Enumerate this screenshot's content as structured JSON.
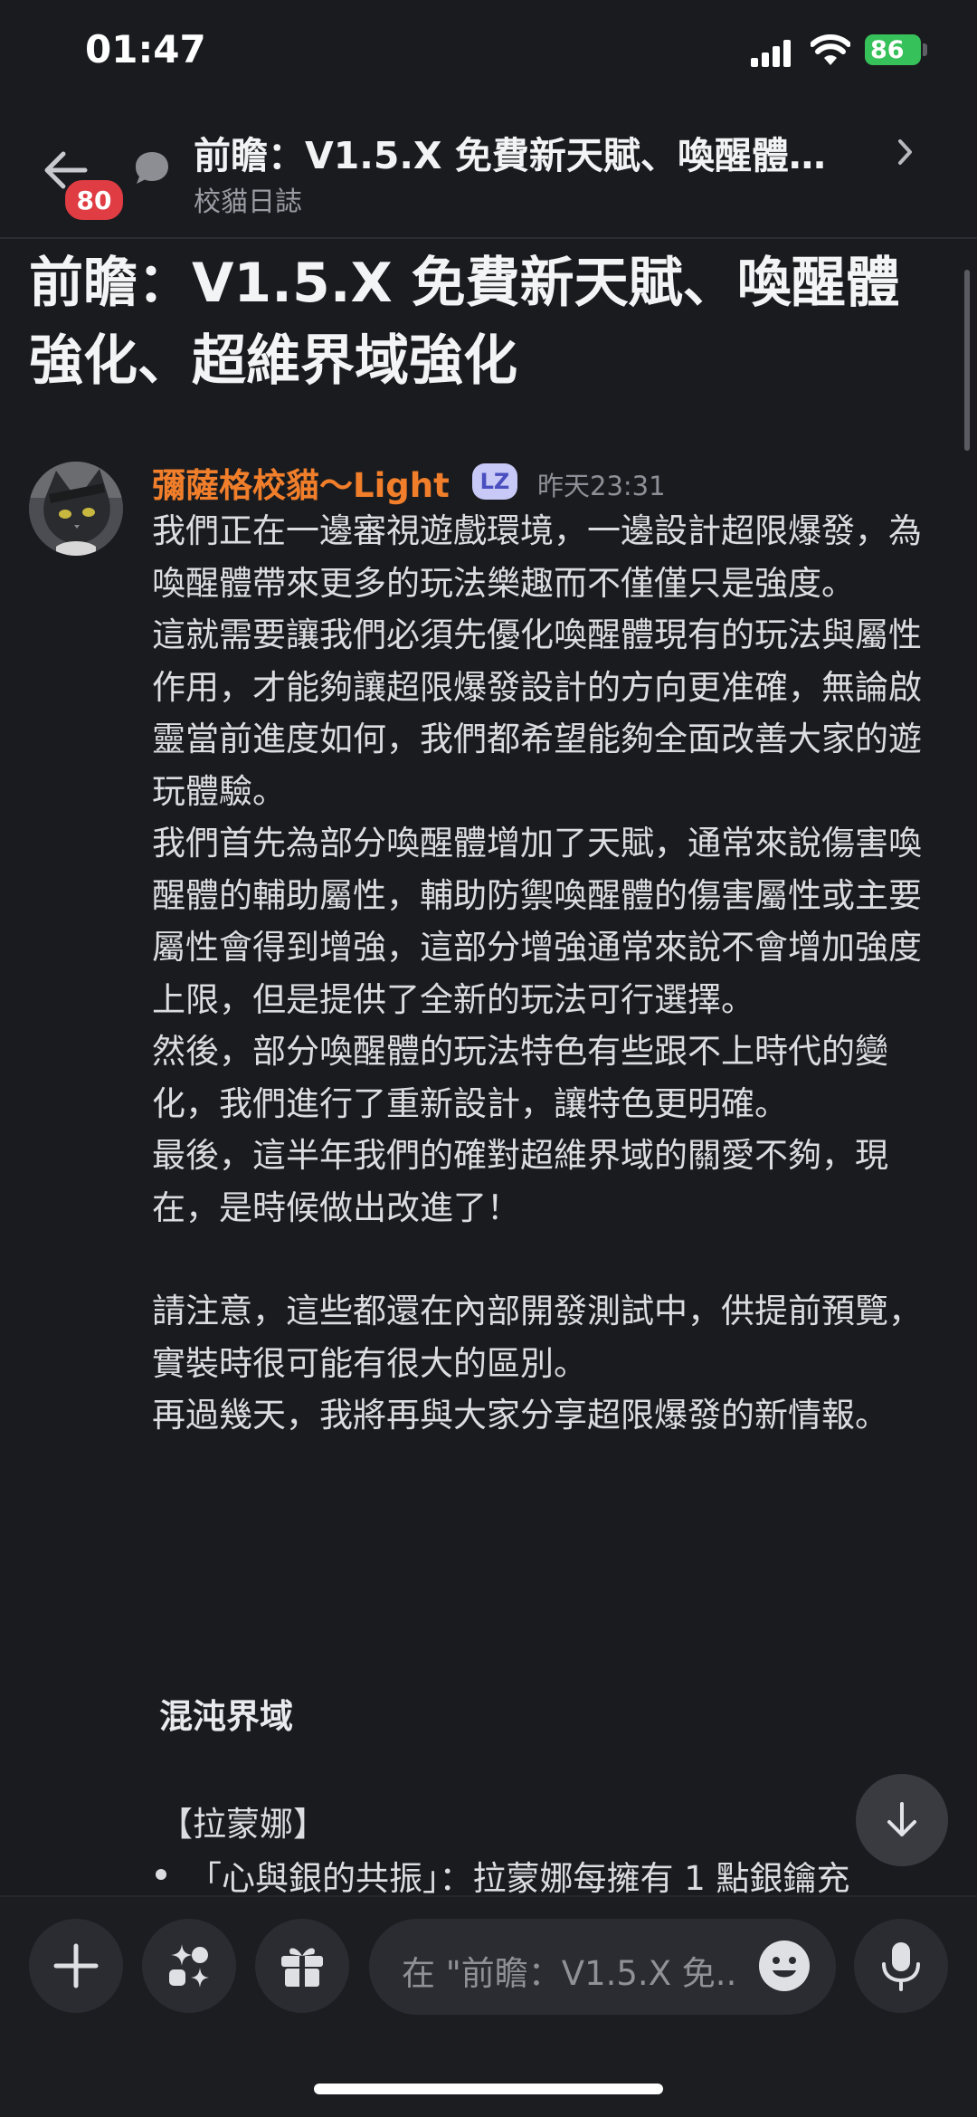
{
  "status_bar": {
    "time": "01:47",
    "battery": "86"
  },
  "header": {
    "back_badge": "80",
    "title": "前瞻：V1.5.X 免費新天賦、喚醒體…",
    "subtitle": "校貓日誌"
  },
  "post": {
    "title_line1": "前瞻：V1.5.X 免費新天賦、喚醒體",
    "title_line2": "強化、超維界域強化"
  },
  "message": {
    "author": "彌薩格校貓～Light",
    "author_tag": "LZ",
    "timestamp": "昨天23:31",
    "paragraphs": [
      "我們正在一邊審視遊戲環境，一邊設計超限爆發，為喚醒體帶來更多的玩法樂趣而不僅僅只是強度。",
      "這就需要讓我們必須先優化喚醒體現有的玩法與屬性作用，才能夠讓超限爆發設計的方向更准確，無論啟靈當前進度如何，我們都希望能夠全面改善大家的遊玩體驗。",
      "我們首先為部分喚醒體增加了天賦，通常來說傷害喚醒體的輔助屬性，輔助防禦喚醒體的傷害屬性或主要屬性會得到增強，這部分增強通常來說不會增加強度上限，但是提供了全新的玩法可行選擇。",
      "然後，部分喚醒體的玩法特色有些跟不上時代的變化，我們進行了重新設計，讓特色更明確。",
      "最後，這半年我們的確對超維界域的關愛不夠，現在，是時候做出改進了！",
      "請注意，這些都還在內部開發測試中，供提前預覽，實裝時很可能有很大的區別。",
      "再過幾天，我將再與大家分享超限爆發的新情報。"
    ],
    "section_title": "混沌界域",
    "subsection": "【拉蒙娜】",
    "bullet": "「心與銀的共振」：拉蒙娜每擁有 1 點銀鑰充"
  },
  "composer": {
    "placeholder": "在 \"前瞻：V1.5.X 免.."
  },
  "icons": {
    "back": "back-arrow-icon",
    "chat": "chat-bubble-icon",
    "chevron": "chevron-right-icon",
    "scroll_down": "arrow-down-icon",
    "plus": "plus-icon",
    "apps": "apps-sparkle-icon",
    "gift": "gift-icon",
    "emoji": "emoji-icon",
    "mic": "microphone-icon"
  },
  "colors": {
    "background": "#1a1b1f",
    "author": "#f07e2a",
    "badge": "#e03c43",
    "battery": "#37c15a"
  }
}
